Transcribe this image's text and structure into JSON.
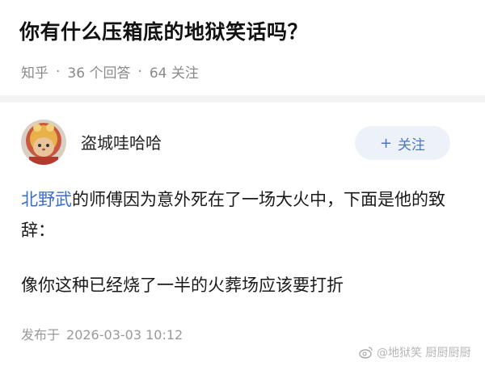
{
  "question": {
    "title": "你有什么压箱底的地狱笑话吗？",
    "source": "知乎",
    "answers_count": "36 个回答",
    "followers_count": "64 关注"
  },
  "author": {
    "name": "盗城哇哈哈",
    "follow_label": "关注",
    "avatar_icon": "cat-lion-costume-avatar"
  },
  "answer": {
    "mention": "北野武",
    "paragraph1_rest": "的师傅因为意外死在了一场大火中，下面是他的致辞：",
    "paragraph2": "像你这种已经烧了一半的火葬场应该要打折",
    "published_label": "发布于",
    "published_time": "2026-03-03 10:12"
  },
  "watermark": {
    "text": "@地狱笑 厨厨厨厨",
    "icon": "weibo-icon"
  },
  "colors": {
    "link": "#3a6ec9",
    "follow_bg": "#edf2f8",
    "follow_text": "#4a76c5",
    "muted": "#8a8a8a"
  }
}
